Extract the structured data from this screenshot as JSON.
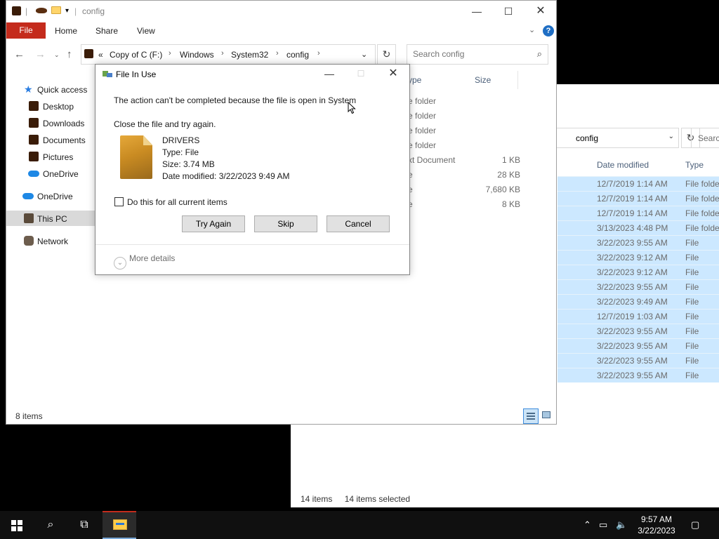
{
  "background_window": {
    "breadcrumb_tail": "config",
    "search_placeholder": "Searc",
    "columns": {
      "date_modified": "Date modified",
      "type": "Type"
    },
    "rows": [
      {
        "date": "12/7/2019 1:14 AM",
        "type": "File folde"
      },
      {
        "date": "12/7/2019 1:14 AM",
        "type": "File folde"
      },
      {
        "date": "12/7/2019 1:14 AM",
        "type": "File folde"
      },
      {
        "date": "3/13/2023 4:48 PM",
        "type": "File folde"
      },
      {
        "date": "3/22/2023 9:55 AM",
        "type": "File"
      },
      {
        "date": "3/22/2023 9:12 AM",
        "type": "File"
      },
      {
        "date": "3/22/2023 9:12 AM",
        "type": "File"
      },
      {
        "date": "3/22/2023 9:55 AM",
        "type": "File"
      },
      {
        "date": "3/22/2023 9:49 AM",
        "type": "File"
      },
      {
        "date": "12/7/2019 1:03 AM",
        "type": "File"
      },
      {
        "date": "3/22/2023 9:55 AM",
        "type": "File"
      },
      {
        "date": "3/22/2023 9:55 AM",
        "type": "File"
      },
      {
        "date": "3/22/2023 9:55 AM",
        "type": "File"
      },
      {
        "date": "3/22/2023 9:55 AM",
        "type": "File"
      }
    ],
    "status": {
      "items": "14 items",
      "selected": "14 items selected"
    }
  },
  "window": {
    "title": "config",
    "ribbon_tabs": {
      "file": "File",
      "home": "Home",
      "share": "Share",
      "view": "View"
    },
    "help": "?",
    "address": [
      "Copy of C (F:)",
      "Windows",
      "System32",
      "config"
    ],
    "address_prefix": "«",
    "search_placeholder": "Search config",
    "nav": {
      "quick_access": "Quick access",
      "desktop": "Desktop",
      "downloads": "Downloads",
      "documents": "Documents",
      "pictures": "Pictures",
      "onedrive_sub": "OneDrive",
      "onedrive": "OneDrive",
      "this_pc": "This PC",
      "network": "Network"
    },
    "columns": {
      "type": "ype",
      "size": "Size"
    },
    "rows": [
      {
        "type": "e folder",
        "size": ""
      },
      {
        "type": "e folder",
        "size": ""
      },
      {
        "type": "e folder",
        "size": ""
      },
      {
        "type": "e folder",
        "size": ""
      },
      {
        "type": "xt Document",
        "size": "1 KB"
      },
      {
        "type": "e",
        "size": "28 KB"
      },
      {
        "type": "e",
        "size": "7,680 KB"
      },
      {
        "type": "e",
        "size": "8 KB"
      }
    ],
    "status": "8 items"
  },
  "dialog": {
    "title": "File In Use",
    "message": "The action can't be completed because the file is open in System",
    "instruction": "Close the file and try again.",
    "file": {
      "name": "DRIVERS",
      "type": "Type: File",
      "size": "Size: 3.74 MB",
      "modified": "Date modified: 3/22/2023 9:49 AM"
    },
    "checkbox_label": "Do this for all current items",
    "buttons": {
      "try_again": "Try Again",
      "skip": "Skip",
      "cancel": "Cancel"
    },
    "more_details": "More details"
  },
  "taskbar": {
    "time": "9:57 AM",
    "date": "3/22/2023"
  },
  "colors": {
    "file_tab": "#c42b1c",
    "selection": "#cce8ff",
    "taskbar": "#101010"
  }
}
